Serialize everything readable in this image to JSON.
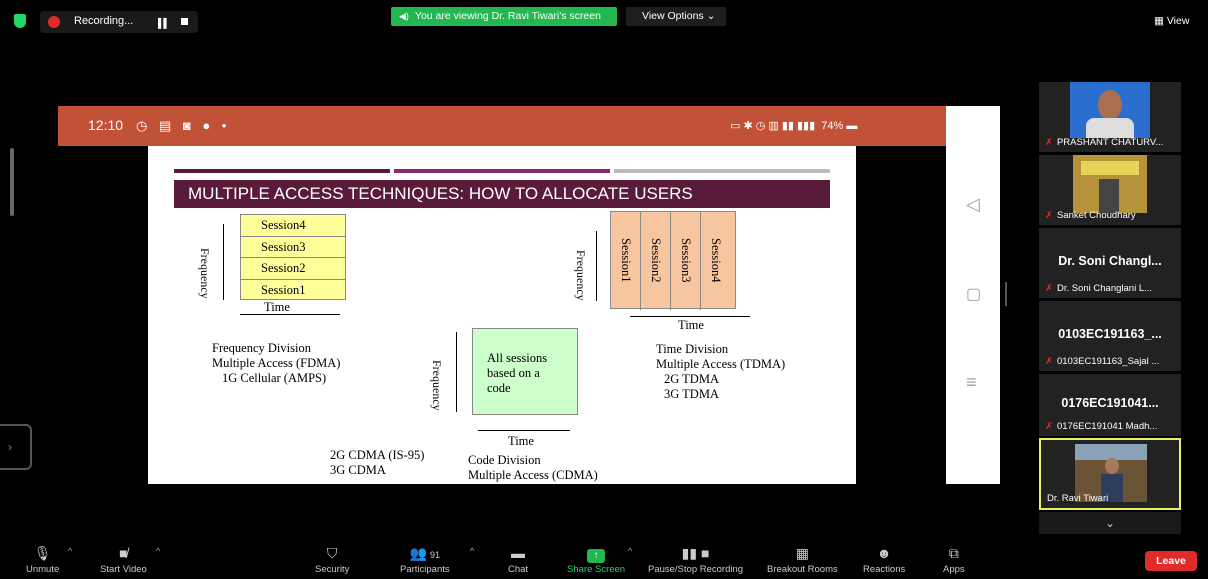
{
  "topbar": {
    "recording_label": "Recording...",
    "viewing_banner": "You are viewing Dr. Ravi Tiwari's screen",
    "view_options": "View Options",
    "view_button": "View",
    "accent_green": "#23b74f",
    "recording_color": "#e02b2b"
  },
  "phone": {
    "time": "12:10",
    "status_right": "74%"
  },
  "slide": {
    "title": "MULTIPLE ACCESS TECHNIQUES: HOW TO ALLOCATE USERS",
    "fdma": {
      "sessions": [
        "Session4",
        "Session3",
        "Session2",
        "Session1"
      ],
      "y_label": "Frequency",
      "x_label": "Time",
      "desc_1": "Frequency Division",
      "desc_2": "Multiple Access (FDMA)",
      "desc_3": "1G Cellular (AMPS)"
    },
    "tdma": {
      "sessions": [
        "Session1",
        "Session2",
        "Session3",
        "Session4"
      ],
      "y_label": "Frequency",
      "x_label": "Time",
      "desc_1": "Time Division",
      "desc_2": "Multiple Access (TDMA)",
      "desc_3": "2G TDMA",
      "desc_4": "3G TDMA"
    },
    "cdma": {
      "box_line_1": "All sessions",
      "box_line_2": "based on a",
      "box_line_3": "code",
      "y_label": "Frequency",
      "x_label": "Time",
      "left_1": "2G CDMA (IS-95)",
      "left_2": "3G CDMA",
      "desc_1": "Code Division",
      "desc_2": "Multiple Access (CDMA)"
    }
  },
  "participants": [
    {
      "name": "PRASHANT CHATURV...",
      "big": "",
      "muted": true
    },
    {
      "name": "Sanket Choudhary",
      "big": "",
      "muted": true
    },
    {
      "name": "Dr. Soni Changlani L...",
      "big": "Dr. Soni Changl...",
      "muted": true
    },
    {
      "name": "0103EC191163_Sajal ...",
      "big": "0103EC191163_...",
      "muted": true
    },
    {
      "name": "0176EC191041 Madh...",
      "big": "0176EC191041...",
      "muted": true
    },
    {
      "name": "Dr. Ravi Tiwari",
      "big": "",
      "muted": false
    }
  ],
  "toolbar": {
    "unmute": "Unmute",
    "start_video": "Start Video",
    "security": "Security",
    "participants": "Participants",
    "participant_count": "91",
    "chat": "Chat",
    "share_screen": "Share Screen",
    "pause_stop_recording": "Pause/Stop Recording",
    "breakout_rooms": "Breakout Rooms",
    "reactions": "Reactions",
    "apps": "Apps",
    "leave": "Leave"
  }
}
